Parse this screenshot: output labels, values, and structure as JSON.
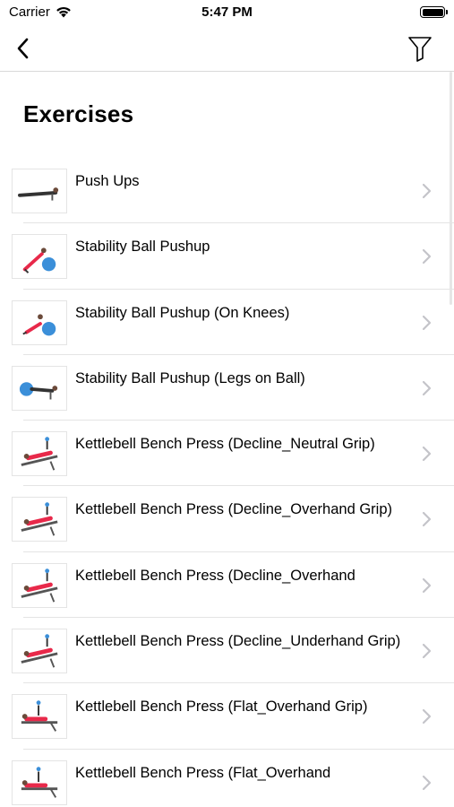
{
  "status_bar": {
    "carrier": "Carrier",
    "time": "5:47 PM"
  },
  "nav": {
    "back_icon": "chevron-left-icon",
    "filter_icon": "filter-icon"
  },
  "page": {
    "title": "Exercises"
  },
  "exercises": [
    {
      "name": "Push Ups",
      "thumb": "pushup"
    },
    {
      "name": "Stability Ball Pushup",
      "thumb": "ball"
    },
    {
      "name": "Stability Ball Pushup (On Knees)",
      "thumb": "ball-knees"
    },
    {
      "name": "Stability Ball Pushup (Legs on Ball)",
      "thumb": "ball-legs"
    },
    {
      "name": "Kettlebell Bench Press (Decline_Neutral Grip)",
      "thumb": "bench-decline"
    },
    {
      "name": "Kettlebell Bench Press (Decline_Overhand Grip)",
      "thumb": "bench-decline"
    },
    {
      "name": "Kettlebell Bench Press (Decline_Overhand",
      "thumb": "bench-decline"
    },
    {
      "name": "Kettlebell Bench Press (Decline_Underhand Grip)",
      "thumb": "bench-decline"
    },
    {
      "name": "Kettlebell Bench Press (Flat_Overhand Grip)",
      "thumb": "bench-flat"
    },
    {
      "name": "Kettlebell Bench Press (Flat_Overhand",
      "thumb": "bench-flat"
    }
  ],
  "colors": {
    "accent": "#e8294a",
    "ball": "#3b8fd9",
    "separator": "#e4e4e4",
    "chevron": "#c4c4c9"
  }
}
